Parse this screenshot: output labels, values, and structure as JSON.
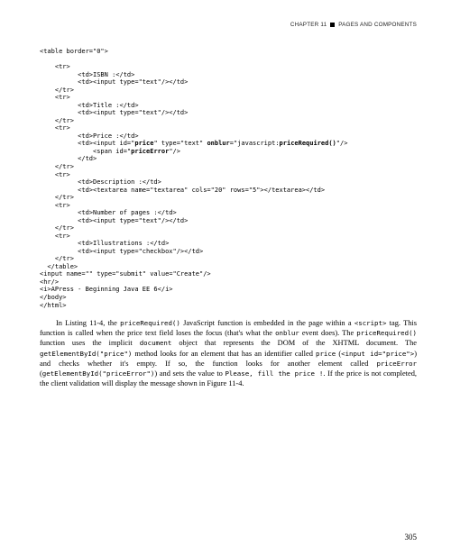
{
  "header": {
    "chapter_label": "CHAPTER 11",
    "chapter_title": "PAGES AND COMPONENTS"
  },
  "code": "<table border=\"0\">\n\n    <tr>\n          <td>ISBN :</td>\n          <td><input type=\"text\"/></td>\n    </tr>\n    <tr>\n          <td>Title :</td>\n          <td><input type=\"text\"/></td>\n    </tr>\n    <tr>\n          <td>Price :</td>\n          <td><input id=\"price\" type=\"text\" onblur=\"javascript:priceRequired()\"/>\n              <span id=\"priceError\"/>\n          </td>\n    </tr>\n    <tr>\n          <td>Description :</td>\n          <td><textarea name=\"textarea\" cols=\"20\" rows=\"5\"></textarea></td>\n    </tr>\n    <tr>\n          <td>Number of pages :</td>\n          <td><input type=\"text\"/></td>\n    </tr>\n    <tr>\n          <td>Illustrations :</td>\n          <td><input type=\"checkbox\"/></td>\n    </tr>\n  </table>\n<input name=\"\" type=\"submit\" value=\"Create\"/>\n<hr/>\n<i>APress - Beginning Java EE 6</i>\n</body>\n</html>",
  "paragraph": {
    "p1_a": "In Listing 11-4, the ",
    "p1_b": "priceRequired()",
    "p1_c": " JavaScript function is embedded in the page within a ",
    "p1_d": "<script>",
    "p1_e": " tag. This function is called when the price text field loses the focus (that's what the ",
    "p1_f": "onblur",
    "p1_g": " event does). The ",
    "p1_h": "priceRequired()",
    "p1_i": " function uses the implicit ",
    "p1_j": "document",
    "p1_k": " object that represents the DOM of the XHTML document. The ",
    "p1_l": "getElementById(\"price\")",
    "p1_m": " method looks for an element that has an identifier called ",
    "p1_n": "price",
    "p1_o": " (",
    "p1_p": "<input id=\"price\">",
    "p1_q": ") and checks whether it's empty. If so, the function looks for another element called ",
    "p1_r": "priceError",
    "p1_s": " (",
    "p1_t": "getElementById(\"priceError\")",
    "p1_u": ") and sets the value to ",
    "p1_v": "Please, fill the price !",
    "p1_w": ". If the price is not completed, the client validation will display the message shown in Figure 11-4."
  },
  "page_number": "305"
}
